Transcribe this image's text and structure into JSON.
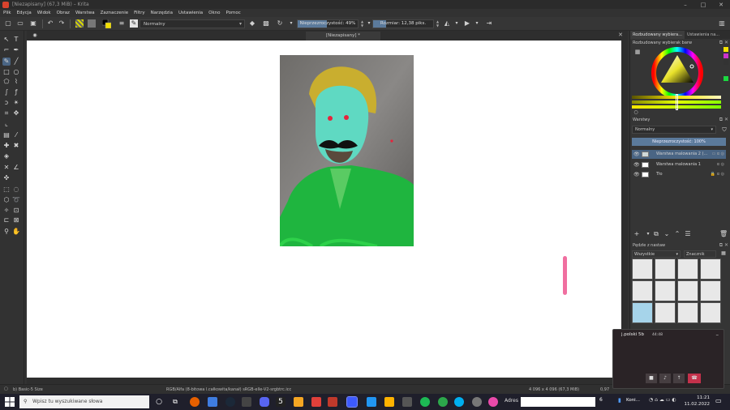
{
  "window": {
    "title": "[Niezapisany]  (67,3 MiB)  – Krita",
    "controls": [
      "–",
      "□",
      "✕"
    ]
  },
  "menu": [
    "Plik",
    "Edycja",
    "Widok",
    "Obraz",
    "Warstwa",
    "Zaznaczenie",
    "Filtry",
    "Narzędzia",
    "Ustawienia",
    "Okno",
    "Pomoc"
  ],
  "toolbar": {
    "blend_mode": "Normalny",
    "opacity_label": "Nieprzezroczystość: 49%",
    "opacity_value": 49,
    "size_label": "Rozmiar: 12,38 piks."
  },
  "canvas": {
    "doc_tab": "[Niezapisany] *"
  },
  "docker": {
    "tabs": [
      "Rozbudowany wybiera...",
      "Ustawienia na..."
    ],
    "color_panel_title": "Rozbudowany wybierak barw",
    "layers_title": "Warstwy",
    "layer_blend": "Normalny",
    "layer_opacity": "Nieprzezroczystość:  100%",
    "layers": [
      {
        "name": "Warstwa malowania 2 (...",
        "selected": true
      },
      {
        "name": "Warstwa malowania 1",
        "selected": false
      },
      {
        "name": "Tło",
        "selected": false
      }
    ],
    "brushes_title": "Pędzle z nastaw",
    "brush_filter": "Wszystkie",
    "brush_tag": "Znacznik"
  },
  "status": {
    "brush": "b) Basic-5 Size",
    "color_space": "RGB/Alfa (8-bitowa l.całkowita/kanał)  sRGB-elle-V2-srgbtrc.icc",
    "dimensions": "4 096 x 4 096 (67,3 MiB)",
    "zoom": "0,97"
  },
  "taskbar": {
    "search_placeholder": "Wpisz tu wyszukiwane słowa",
    "address_label": "Adres",
    "tray_label": "Koni...",
    "time": "11:21",
    "date": "11.02.2022",
    "notif_count": "6"
  },
  "call": {
    "name": "j.polski 5b",
    "duration": "44:48"
  },
  "colors": {
    "accent": "#5b7a9b",
    "selection": "#4a6584",
    "canvas": "#ffffff"
  }
}
